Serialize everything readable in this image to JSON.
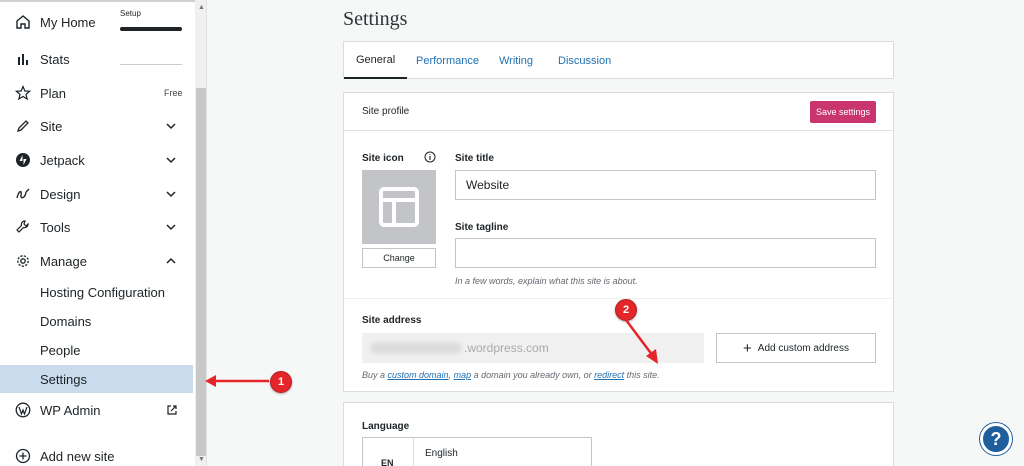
{
  "sidebar": {
    "setup_label": "Setup",
    "items": [
      {
        "label": "My Home",
        "icon": "home-icon"
      },
      {
        "label": "Stats",
        "icon": "stats-icon"
      },
      {
        "label": "Plan",
        "icon": "star-icon",
        "badge": "Free"
      },
      {
        "label": "Site",
        "icon": "pencil-icon"
      },
      {
        "label": "Jetpack",
        "icon": "jetpack-icon"
      },
      {
        "label": "Design",
        "icon": "design-icon"
      },
      {
        "label": "Tools",
        "icon": "wrench-icon"
      },
      {
        "label": "Manage",
        "icon": "gear-icon"
      }
    ],
    "manage_sub": [
      "Hosting Configuration",
      "Domains",
      "People",
      "Settings"
    ],
    "wp_admin": "WP Admin",
    "add_new_site": "Add new site"
  },
  "annotations": {
    "badge1": "1",
    "badge2": "2",
    "color": "#e4262b"
  },
  "main": {
    "title": "Settings",
    "tabs": [
      "General",
      "Performance",
      "Writing",
      "Discussion"
    ],
    "profile": {
      "heading": "Site profile",
      "save_label": "Save settings",
      "site_icon_label": "Site icon",
      "change_label": "Change",
      "site_title_label": "Site title",
      "site_title_value": "Website",
      "tagline_label": "Site tagline",
      "tagline_value": "",
      "tagline_hint": "In a few words, explain what this site is about.",
      "address_label": "Site address",
      "address_suffix": ".wordpress.com",
      "add_custom_label": "Add custom address",
      "hint_prefix": "Buy a ",
      "hint_link1": "custom domain",
      "hint_mid1": ", ",
      "hint_link2": "map",
      "hint_mid2": " a domain you already own, or ",
      "hint_link3": "redirect",
      "hint_suffix": " this site."
    },
    "language": {
      "label": "Language",
      "code": "EN",
      "name": "English"
    }
  },
  "colors": {
    "accent": "#2271b1",
    "save_button": "#c9356e",
    "active_nav": "#c9dbec",
    "help": "#1e5e9c"
  }
}
